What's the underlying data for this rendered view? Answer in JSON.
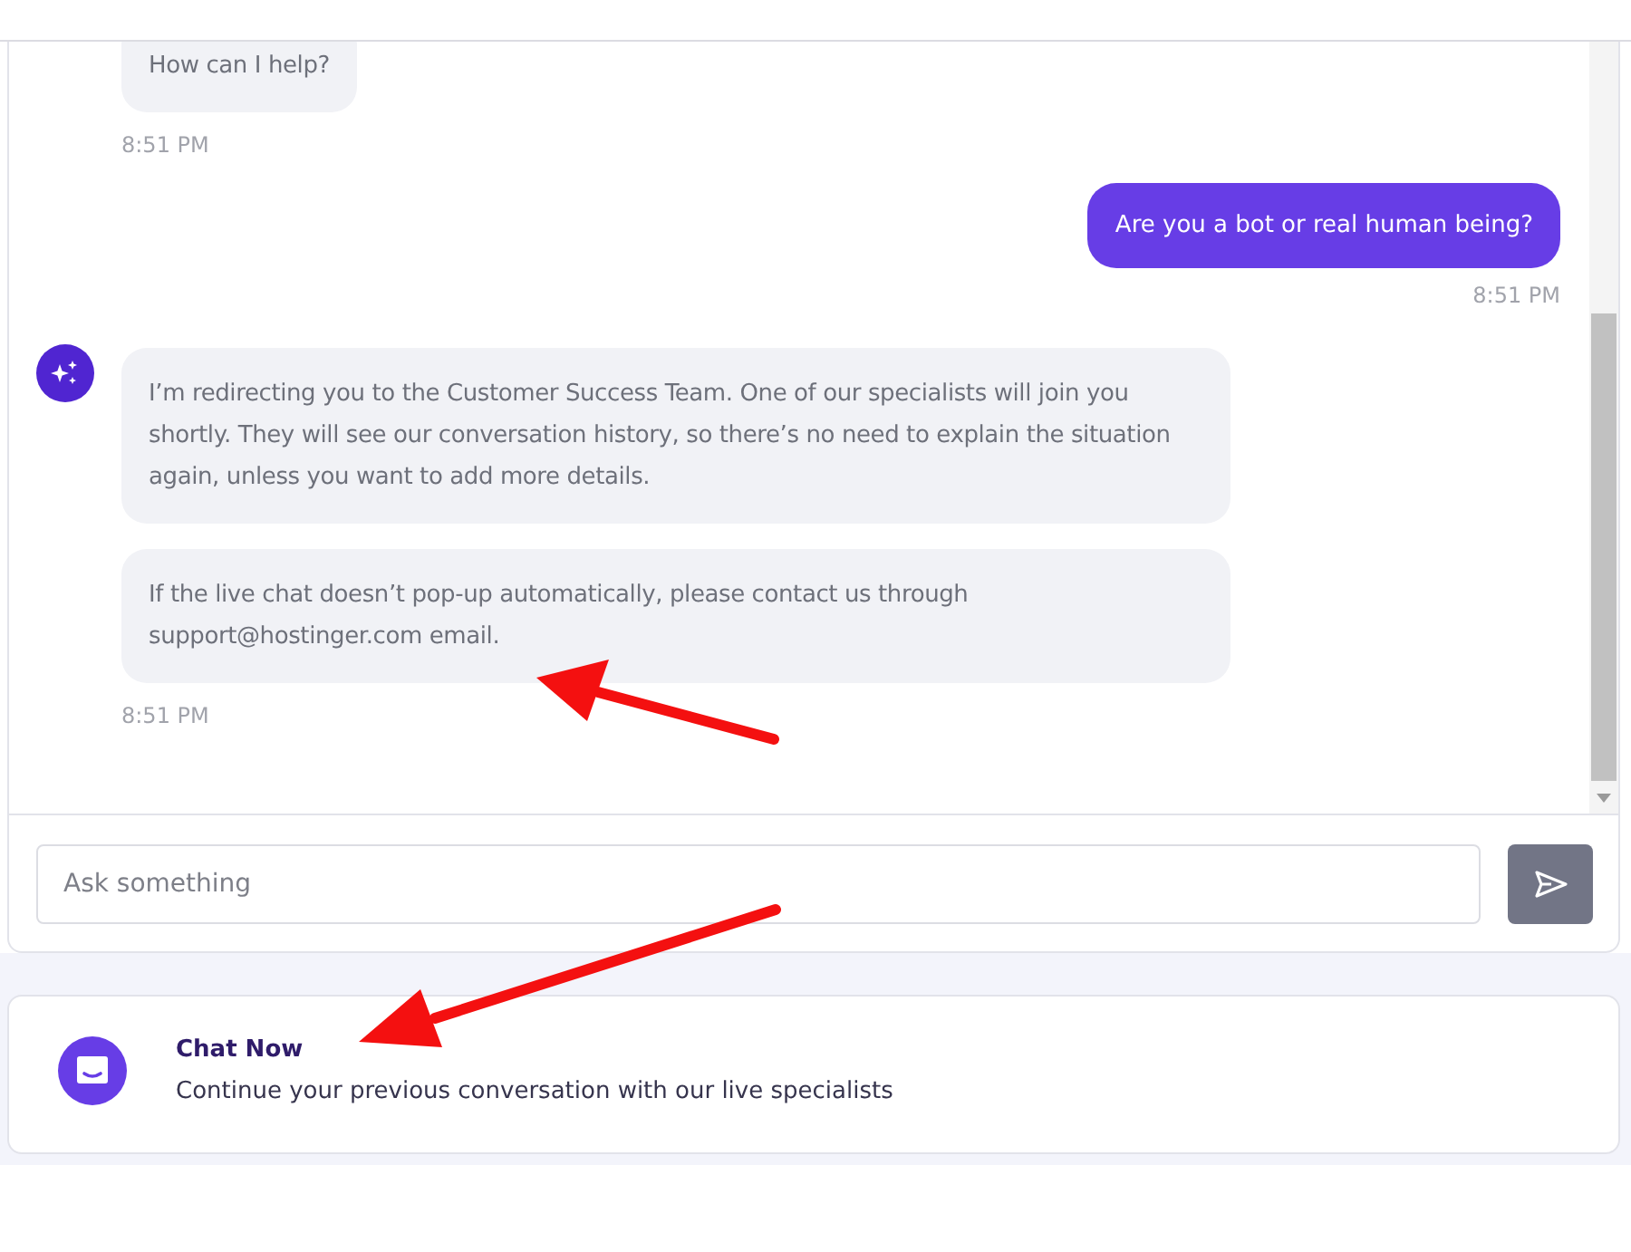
{
  "messages": [
    {
      "kind": "bot",
      "avatar": false,
      "bubbles": [
        "How can I help?"
      ],
      "time": "8:51 PM"
    },
    {
      "kind": "user",
      "avatar": false,
      "bubbles": [
        "Are you a bot or real human being?"
      ],
      "time": "8:51 PM"
    },
    {
      "kind": "bot",
      "avatar": true,
      "bubbles": [
        "I’m redirecting you to the Customer Success Team. One of our specialists will join you shortly. They will see our conversation history, so there’s no need to explain the situation again, unless you want to add more details.",
        "If the live chat doesn’t pop-up automatically, please contact us through support@hostinger.com email."
      ],
      "time": "8:51 PM"
    }
  ],
  "composer": {
    "placeholder": "Ask something"
  },
  "chat_now": {
    "title": "Chat Now",
    "subtitle": "Continue your previous conversation with our live specialists"
  }
}
